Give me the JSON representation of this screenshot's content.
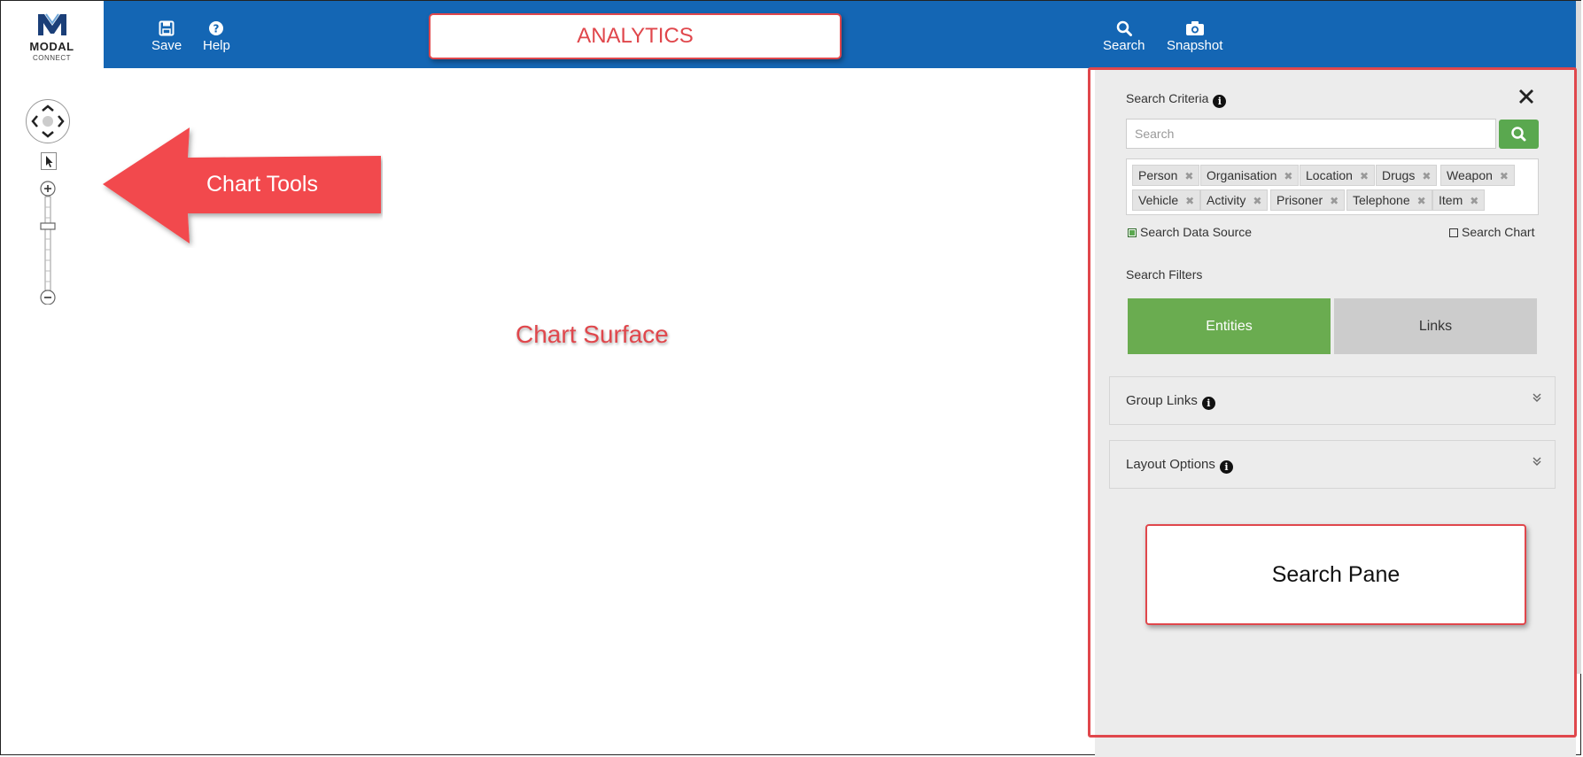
{
  "logo": {
    "name": "MODAL",
    "sub": "CONNECT"
  },
  "toolbar": {
    "save_label": "Save",
    "help_label": "Help",
    "search_label": "Search",
    "snapshot_label": "Snapshot",
    "page_title": "ANALYTICS"
  },
  "annotations": {
    "chart_tools": "Chart Tools",
    "chart_surface": "Chart Surface",
    "search_pane": "Search Pane"
  },
  "search_pane": {
    "criteria_label": "Search Criteria",
    "search_placeholder": "Search",
    "tags_row1": [
      "Person",
      "Organisation",
      "Location",
      "Drugs",
      "Weapon"
    ],
    "tags_row2": [
      "Vehicle",
      "Activity",
      "Prisoner",
      "Telephone",
      "Item"
    ],
    "search_data_source_label": "Search Data Source",
    "search_data_source_checked": true,
    "search_chart_label": "Search Chart",
    "search_chart_checked": false,
    "filters_label": "Search Filters",
    "filter_entities": "Entities",
    "filter_links": "Links",
    "active_filter": "Entities",
    "group_links_label": "Group Links",
    "layout_options_label": "Layout Options"
  },
  "colors": {
    "toolbar_blue": "#1466b4",
    "accent_green": "#6aac50",
    "annotation_red": "#e0474c"
  }
}
